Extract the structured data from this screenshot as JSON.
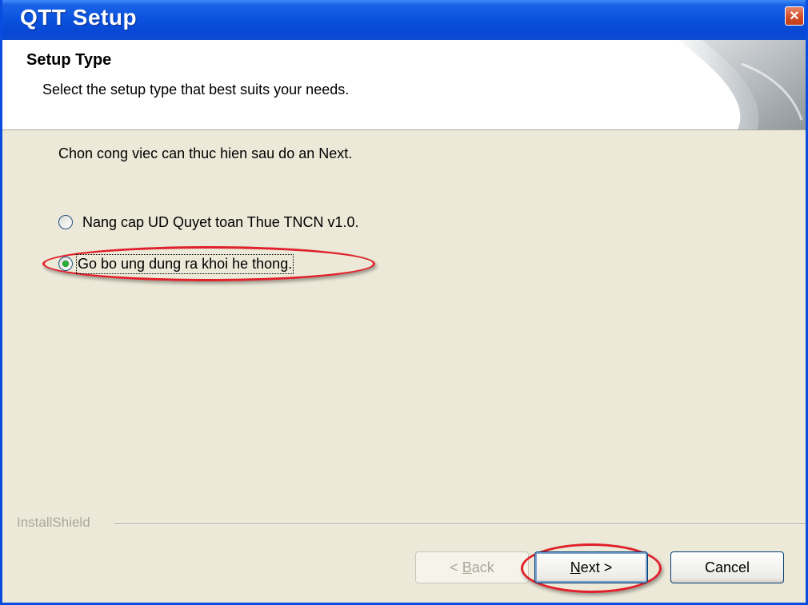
{
  "window": {
    "title": "QTT Setup",
    "close_icon": "close-icon"
  },
  "header": {
    "title": "Setup Type",
    "description": "Select the setup type that best suits your needs."
  },
  "body": {
    "instruction": "Chon cong viec can thuc hien sau do an Next.",
    "options": [
      {
        "label": "Nang cap UD Quyet toan Thue TNCN v1.0.",
        "selected": false
      },
      {
        "label": "Go bo ung dung ra khoi he thong.",
        "selected": true
      }
    ]
  },
  "footer": {
    "brand": "InstallShield",
    "back_prefix": "< ",
    "back_key": "B",
    "back_rest": "ack",
    "next_key": "N",
    "next_rest": "ext >",
    "cancel": "Cancel"
  },
  "colors": {
    "titlebar": "#0a53df",
    "highlight": "#e0202a",
    "panel": "#ece9d8"
  }
}
